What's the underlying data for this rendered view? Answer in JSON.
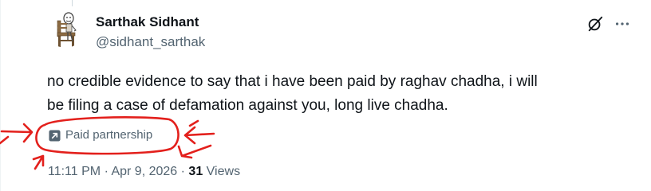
{
  "author": {
    "display_name": "Sarthak Sidhant",
    "handle": "@sidhant_sarthak",
    "avatar_icon": "cartoon-figure-on-chair-avatar"
  },
  "header_actions": {
    "grok_icon": "grok-icon",
    "more_icon": "more-horizontal-icon"
  },
  "tweet": {
    "text": "no credible evidence to say that i have been paid by raghav chadha, i will\nbe filing a case of defamation against you, long live chadha."
  },
  "badge": {
    "icon": "arrow-up-right-square-icon",
    "label": "Paid partnership"
  },
  "meta": {
    "time": "11:11 PM",
    "separator": "·",
    "date": "Apr 9, 2026",
    "views_count": "31",
    "views_label": "Views"
  },
  "annotation": {
    "color": "#e3201c",
    "description_icon": "hand-drawn-circle-and-arrows"
  },
  "colors": {
    "text_primary": "#0f1419",
    "text_secondary": "#536471",
    "background": "#ffffff"
  }
}
